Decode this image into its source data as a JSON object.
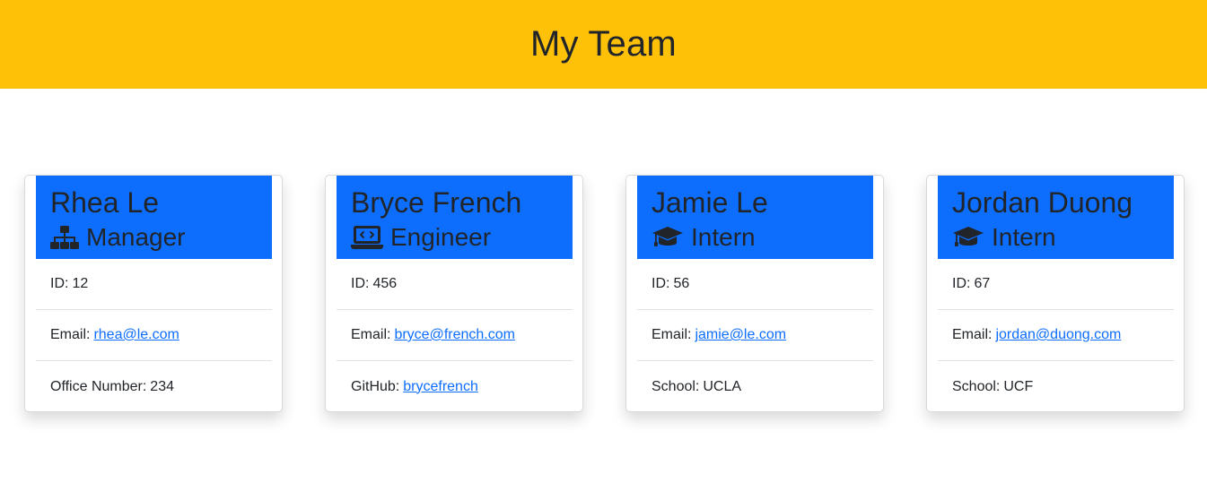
{
  "header": {
    "title": "My Team"
  },
  "colors": {
    "header_bg": "#ffc107",
    "card_head_bg": "#0d6efd",
    "link": "#0d6efd"
  },
  "cards": [
    {
      "name": "Rhea Le",
      "role": "Manager",
      "role_icon": "sitemap-icon",
      "id_label": "ID:",
      "id_value": "12",
      "email_label": "Email:",
      "email": "rhea@le.com",
      "extra_label": "Office Number:",
      "extra_value": "234"
    },
    {
      "name": "Bryce French",
      "role": "Engineer",
      "role_icon": "laptop-code-icon",
      "id_label": "ID:",
      "id_value": "456",
      "email_label": "Email:",
      "email": "bryce@french.com",
      "extra_label": "GitHub:",
      "extra_value": "brycefrench"
    },
    {
      "name": "Jamie Le",
      "role": "Intern",
      "role_icon": "graduation-cap-icon",
      "id_label": "ID:",
      "id_value": "56",
      "email_label": "Email:",
      "email": "jamie@le.com",
      "extra_label": "School:",
      "extra_value": "UCLA"
    },
    {
      "name": "Jordan Duong",
      "role": "Intern",
      "role_icon": "graduation-cap-icon",
      "id_label": "ID:",
      "id_value": "67",
      "email_label": "Email:",
      "email": "jordan@duong.com",
      "extra_label": "School:",
      "extra_value": "UCF"
    }
  ]
}
